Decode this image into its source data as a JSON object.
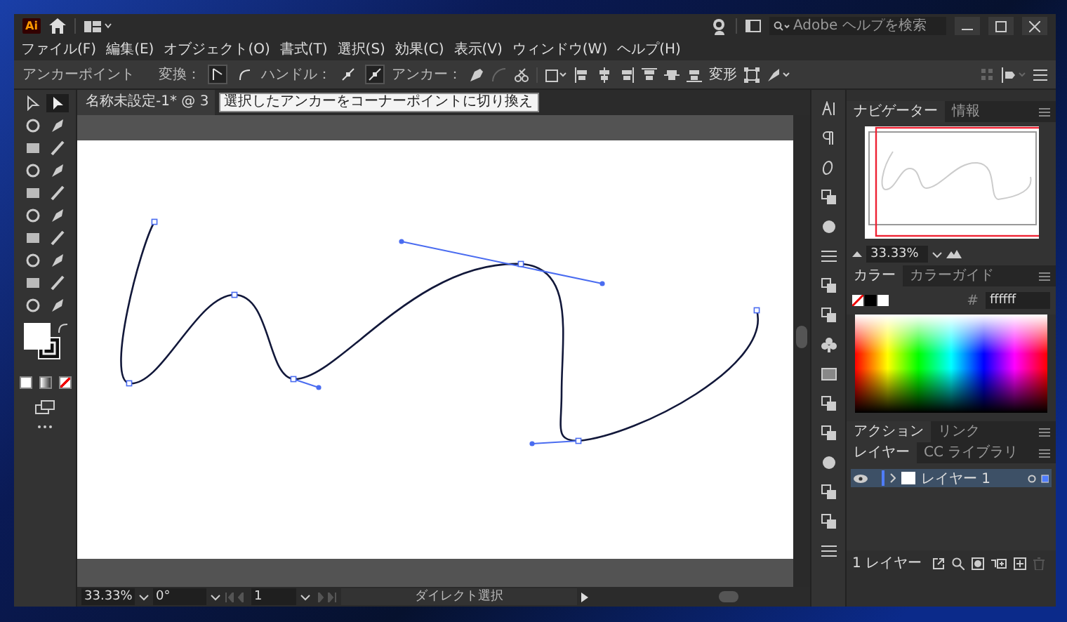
{
  "app_logo": "Ai",
  "search": {
    "placeholder": "Adobe ヘルプを検索"
  },
  "menus": [
    "ファイル(F)",
    "編集(E)",
    "オブジェクト(O)",
    "書式(T)",
    "選択(S)",
    "効果(C)",
    "表示(V)",
    "ウィンドウ(W)",
    "ヘルプ(H)"
  ],
  "control_bar": {
    "title": "アンカーポイント",
    "convert_label": "変換：",
    "convert_buttons": [
      {
        "selected": true
      },
      {
        "selected": false
      }
    ],
    "handle_label": "ハンドル：",
    "handle_buttons": [
      {
        "selected": false
      },
      {
        "selected": true
      }
    ],
    "anchor_label": "アンカー：",
    "transform_label": "変形"
  },
  "tools": [
    {
      "selected": false
    },
    {
      "selected": true
    },
    {
      "selected": false
    },
    {
      "selected": false
    },
    {
      "selected": false
    },
    {
      "selected": false
    },
    {
      "selected": false
    },
    {
      "selected": false
    },
    {
      "selected": false
    },
    {
      "selected": false
    },
    {
      "selected": false
    },
    {
      "selected": false
    },
    {
      "selected": false
    },
    {
      "selected": false
    },
    {
      "selected": false
    },
    {
      "selected": false
    },
    {
      "selected": false
    },
    {
      "selected": false
    },
    {
      "selected": false
    },
    {
      "selected": false
    }
  ],
  "document_tab": {
    "label": "名称未設定-1* @ 3"
  },
  "tooltip": "選択したアンカーをコーナーポイントに切り換え",
  "status_bar": {
    "zoom": "33.33%",
    "rotation": "0°",
    "artboard": "1",
    "tool": "ダイレクト選択"
  },
  "navigator": {
    "tabs": [
      {
        "label": "ナビゲーター",
        "selected": true
      },
      {
        "label": "情報",
        "selected": false
      }
    ],
    "zoom": "33.33%"
  },
  "color": {
    "tabs": [
      {
        "label": "カラー",
        "selected": true
      },
      {
        "label": "カラーガイド",
        "selected": false
      }
    ],
    "hash_label": "#",
    "hex": "ffffff"
  },
  "actions": {
    "tabs": [
      {
        "label": "アクション",
        "selected": true
      },
      {
        "label": "リンク",
        "selected": false
      }
    ]
  },
  "layers": {
    "tabs": [
      {
        "label": "レイヤー",
        "selected": true
      },
      {
        "label": "CC ライブラリ",
        "selected": false
      }
    ],
    "items": [
      {
        "name": "レイヤー 1",
        "visible": true,
        "selected": true,
        "color": "#4f7dff"
      }
    ],
    "count": "1 レイヤー"
  }
}
